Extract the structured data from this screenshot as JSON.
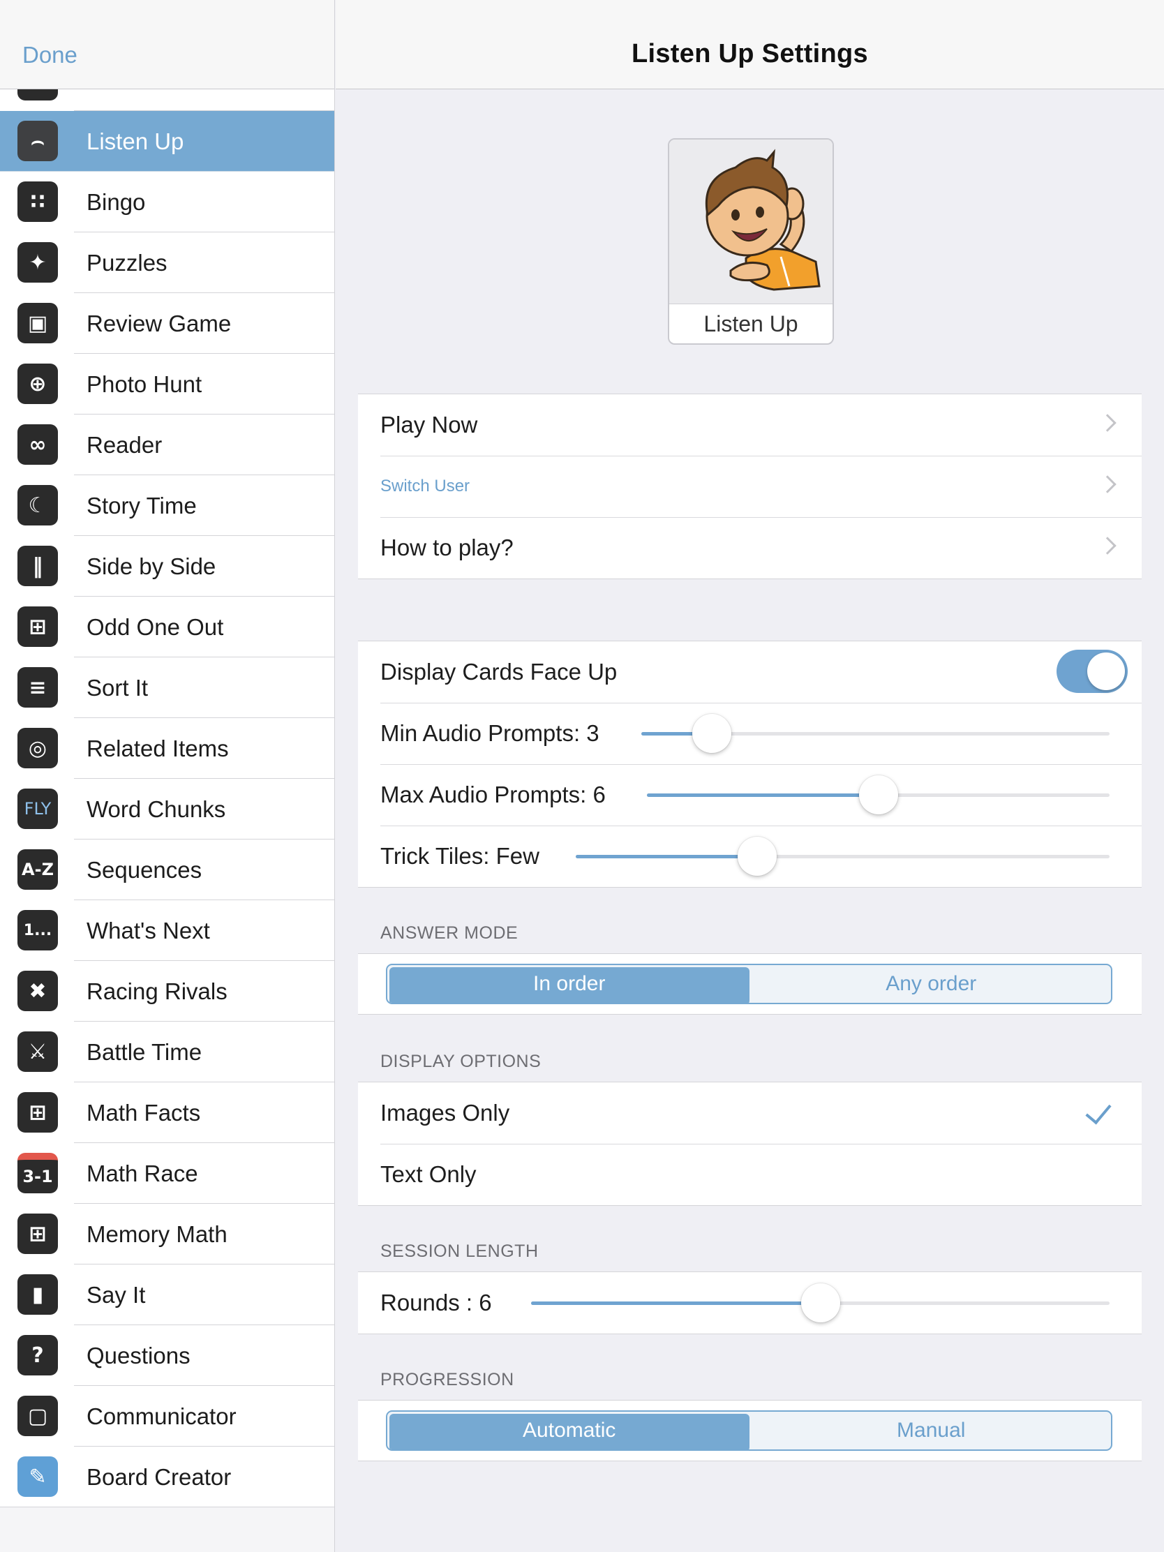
{
  "sidebar": {
    "done_label": "Done",
    "items": [
      {
        "label": "Listen Up",
        "icon": "ear-icon",
        "active": true
      },
      {
        "label": "Bingo",
        "icon": "bingo-grid-icon"
      },
      {
        "label": "Puzzles",
        "icon": "puzzle-piece-icon"
      },
      {
        "label": "Review Game",
        "icon": "review-game-icon"
      },
      {
        "label": "Photo Hunt",
        "icon": "crosshair-icon"
      },
      {
        "label": "Reader",
        "icon": "glasses-icon"
      },
      {
        "label": "Story Time",
        "icon": "moon-icon"
      },
      {
        "label": "Side by Side",
        "icon": "columns-icon"
      },
      {
        "label": "Odd One Out",
        "icon": "grid-odd-icon"
      },
      {
        "label": "Sort It",
        "icon": "sort-icon"
      },
      {
        "label": "Related Items",
        "icon": "circles-icon"
      },
      {
        "label": "Word Chunks",
        "icon": "fly-text-icon",
        "icon_text": "FLY"
      },
      {
        "label": "Sequences",
        "icon": "a-z-icon",
        "icon_text": "A-Z"
      },
      {
        "label": "What's Next",
        "icon": "one-dots-icon",
        "icon_text": "1..."
      },
      {
        "label": "Racing Rivals",
        "icon": "crossed-flags-icon"
      },
      {
        "label": "Battle Time",
        "icon": "crossed-axes-icon"
      },
      {
        "label": "Math Facts",
        "icon": "calculator-icon"
      },
      {
        "label": "Math Race",
        "icon": "math-race-icon",
        "icon_text": "3-1"
      },
      {
        "label": "Memory Math",
        "icon": "memory-grid-icon"
      },
      {
        "label": "Say It",
        "icon": "microphone-icon"
      },
      {
        "label": "Questions",
        "icon": "question-bubble-icon"
      },
      {
        "label": "Communicator",
        "icon": "chat-bubbles-icon"
      },
      {
        "label": "Board Creator",
        "icon": "pencil-icon"
      }
    ]
  },
  "header": {
    "title": "Listen Up Settings"
  },
  "game_card": {
    "name": "Listen Up"
  },
  "actions": {
    "play_now": "Play Now",
    "switch_user": "Switch User",
    "how_to_play": "How to play?"
  },
  "settings": {
    "display_cards_face_up": {
      "label": "Display Cards Face Up",
      "on": true
    },
    "min_audio": {
      "label": "Min Audio Prompts: 3",
      "value": 3,
      "fraction": 0.15
    },
    "max_audio": {
      "label": "Max Audio Prompts: 6",
      "value": 6,
      "fraction": 0.5
    },
    "trick_tiles": {
      "label": "Trick Tiles: Few",
      "fraction": 0.34
    }
  },
  "answer_mode": {
    "title": "ANSWER MODE",
    "options": [
      "In order",
      "Any order"
    ],
    "selected": "In order"
  },
  "display_options": {
    "title": "DISPLAY OPTIONS",
    "options": [
      {
        "label": "Images Only",
        "checked": true
      },
      {
        "label": "Text Only",
        "checked": false
      }
    ]
  },
  "session_length": {
    "title": "SESSION LENGTH",
    "rounds": {
      "label": "Rounds : 6",
      "value": 6,
      "fraction": 0.5
    }
  },
  "progression": {
    "title": "PROGRESSION",
    "options": [
      "Automatic",
      "Manual"
    ],
    "selected": "Automatic"
  },
  "colors": {
    "accent": "#76a9d2",
    "link": "#6a9fcc",
    "toggle": "#6fa3d0"
  }
}
